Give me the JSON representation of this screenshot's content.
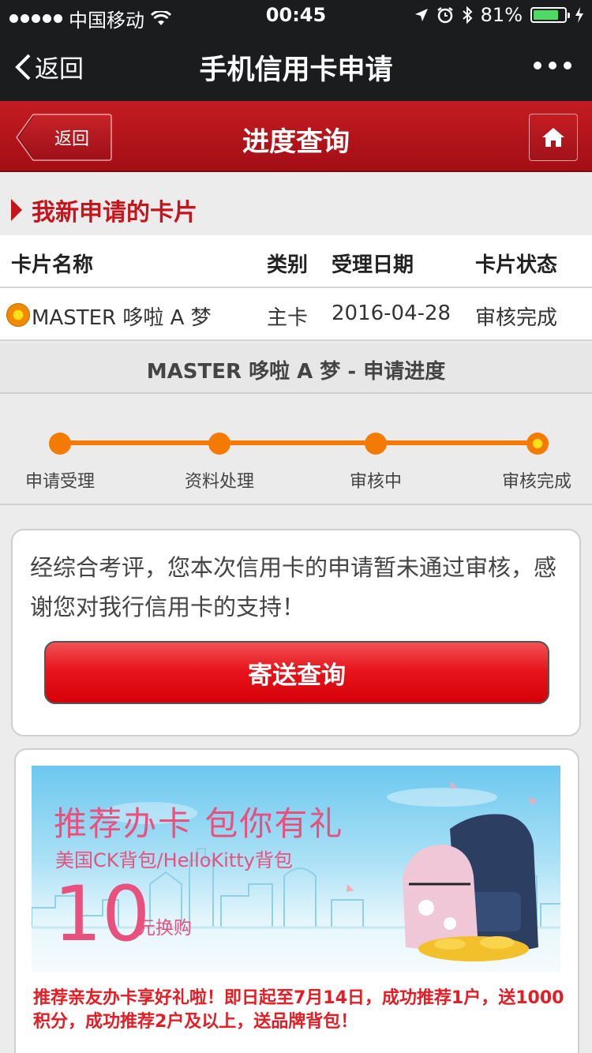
{
  "status_bar": {
    "carrier": "中国移动",
    "time": "00:45",
    "battery": "81%",
    "battery_level": 0.81
  },
  "wechat_nav": {
    "back_label": "返回",
    "title": "手机信用卡申请"
  },
  "bank_header": {
    "back_label": "返回",
    "title": "进度查询"
  },
  "section": {
    "title": "我新申请的卡片"
  },
  "table": {
    "headers": [
      "卡片名称",
      "类别",
      "受理日期",
      "卡片状态"
    ],
    "rows": [
      {
        "name": "MASTER 哆啦 A 梦",
        "type": "主卡",
        "date": "2016-04-28",
        "status": "审核完成"
      }
    ]
  },
  "progress": {
    "title": "MASTER 哆啦 A 梦 - 申请进度",
    "steps": [
      "申请受理",
      "资料处理",
      "审核中",
      "审核完成"
    ],
    "current_step": 4
  },
  "message": {
    "text": "经综合考评，您本次信用卡的申请暂未通过审核，感谢您对我行信用卡的支持！",
    "button_label": "寄送查询"
  },
  "ad": {
    "banner_title": "推荐办卡 包你有礼",
    "banner_subtitle": "美国CK背包/HelloKitty背包",
    "banner_price": "10",
    "banner_price_unit": "元换购",
    "text": "推荐亲友办卡享好礼啦！即日起至7月14日，成功推荐1户，送1000积分，成功推荐2户及以上，送品牌背包！"
  },
  "colors": {
    "brand_red": "#c4141c",
    "progress_orange": "#f47a00",
    "banner_pink": "#e8517e"
  }
}
